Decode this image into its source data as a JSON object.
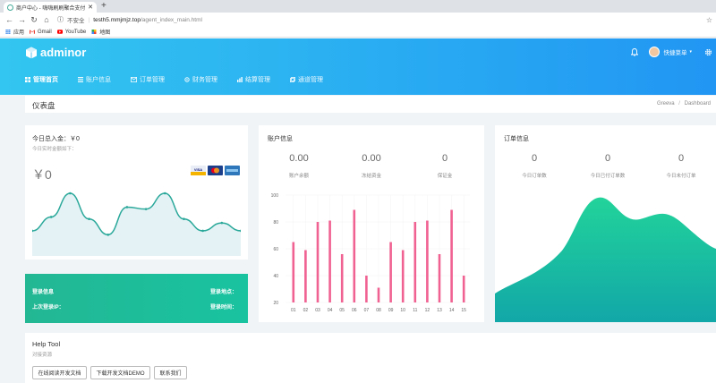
{
  "browser": {
    "tab_title": "商户中心 - 嗨嗨刷刷聚合支付系统",
    "address_insecure": "不安全",
    "address_host": "testh5.mmjmjz.top",
    "address_path": "/agent_index_main.html",
    "bookmarks": [
      {
        "label": "应用"
      },
      {
        "label": "Gmail"
      },
      {
        "label": "YouTube"
      },
      {
        "label": "地图"
      }
    ]
  },
  "header": {
    "logo": "adminor",
    "user_name": "快捷菜单",
    "nav": [
      {
        "label": "管理首页",
        "active": true
      },
      {
        "label": "账户信息"
      },
      {
        "label": "订单管理"
      },
      {
        "label": "财务管理"
      },
      {
        "label": "结算管理"
      },
      {
        "label": "通道管理"
      }
    ]
  },
  "page": {
    "title": "仪表盘",
    "breadcrumb_home": "Greeva",
    "breadcrumb_sep": "/",
    "breadcrumb_current": "Dashboard"
  },
  "income_card": {
    "title": "今日总入金：￥0",
    "subtitle": "今日实时金额如下：",
    "amount": "￥0",
    "sparkline": [
      20,
      34,
      58,
      32,
      16,
      44,
      42,
      58,
      32,
      20,
      28,
      20
    ],
    "color": "#2aa89a"
  },
  "account_card": {
    "title": "账户信息",
    "stats": [
      {
        "value": "0.00",
        "label": "账户余额"
      },
      {
        "value": "0.00",
        "label": "冻结资金"
      },
      {
        "value": "0",
        "label": "保证金"
      }
    ]
  },
  "chart_data": {
    "type": "bar",
    "categories": [
      "01",
      "02",
      "03",
      "04",
      "05",
      "06",
      "07",
      "08",
      "09",
      "10",
      "11",
      "12",
      "13",
      "14",
      "15"
    ],
    "values": [
      65,
      59,
      80,
      81,
      56,
      89,
      40,
      31,
      65,
      59,
      80,
      81,
      56,
      89,
      40
    ],
    "ylim": [
      20,
      100
    ],
    "yticks": [
      "100",
      "80",
      "60",
      "40",
      "20"
    ],
    "color": "#f06292"
  },
  "order_card": {
    "title": "订单信息",
    "stats": [
      {
        "value": "0",
        "label": "今日订单数"
      },
      {
        "value": "0",
        "label": "今日已付订单数"
      },
      {
        "value": "0",
        "label": "今日未付订单"
      }
    ]
  },
  "login_card": {
    "login_info": "登录信息",
    "login_place": "登录地点：",
    "last_ip": "上次登录IP：",
    "login_time": "登录时间："
  },
  "help": {
    "title": "Help Tool",
    "subtitle": "对接资源",
    "buttons": [
      {
        "label": "在线阅读开发文档"
      },
      {
        "label": "下载开发文档DEMO"
      },
      {
        "label": "联系我们"
      }
    ]
  }
}
